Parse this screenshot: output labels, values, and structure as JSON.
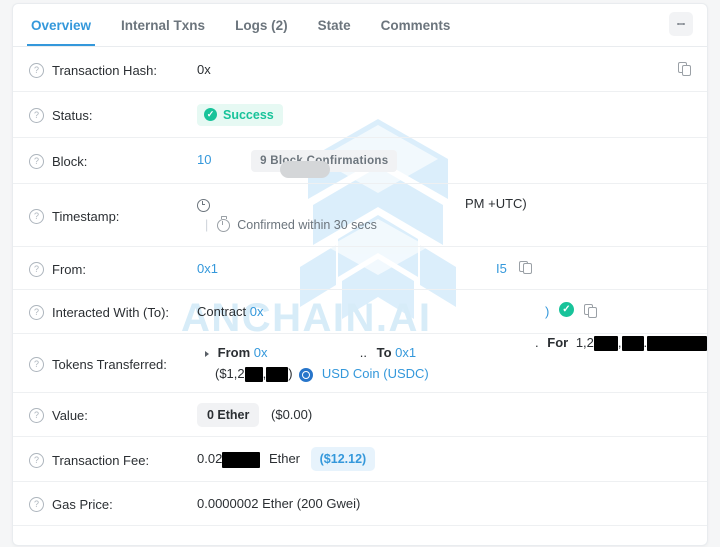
{
  "tabs": {
    "items": [
      {
        "label": "Overview",
        "active": true
      },
      {
        "label": "Internal Txns",
        "active": false
      },
      {
        "label": "Logs (2)",
        "active": false
      },
      {
        "label": "State",
        "active": false
      },
      {
        "label": "Comments",
        "active": false
      }
    ],
    "menu_icon": "kebab-menu-icon"
  },
  "watermark": {
    "text": "ANCHAIN.AI",
    "logo_icon": "hexagon-cube-logo",
    "color": "#d7ecf8"
  },
  "rows": {
    "transaction_hash": {
      "label": "Transaction Hash:",
      "value": "0x",
      "copy_icon": "copy-icon"
    },
    "status": {
      "label": "Status:",
      "value": "Success",
      "icon": "check-circle-icon",
      "badge_bg": "#e6f9f3",
      "badge_fg": "#18c39a"
    },
    "block": {
      "label": "Block:",
      "value": "10",
      "confirmations": "9 Block Confirmations"
    },
    "timestamp": {
      "label": "Timestamp:",
      "clock_icon": "clock-icon",
      "right_text": "PM +UTC)",
      "separator": "|",
      "confirm_icon": "stopwatch-icon",
      "confirm_text": "Confirmed within 30 secs"
    },
    "from": {
      "label": "From:",
      "value": "0x1",
      "tail": "I5",
      "copy_icon": "copy-icon"
    },
    "interacted_with": {
      "label": "Interacted With (To):",
      "prefix": "Contract",
      "value": "0x",
      "tail": ")",
      "verified_icon": "check-circle-icon",
      "copy_icon": "copy-icon"
    },
    "tokens_transferred": {
      "label": "Tokens Transferred:",
      "caret_icon": "caret-right-icon",
      "from_label": "From",
      "from_value": "0x",
      "ellipsis": "..",
      "to_label": "To",
      "to_value": "0x1",
      "period": ".",
      "for_label": "For",
      "for_value": "1,2",
      "usd_value": "($1,2",
      "usd_close": ")",
      "token_icon": "usdc-token-icon",
      "token_name": "USD Coin (USDC)"
    },
    "value": {
      "label": "Value:",
      "amount": "0 Ether",
      "fiat": "($0.00)"
    },
    "transaction_fee": {
      "label": "Transaction Fee:",
      "amount_prefix": "0.02",
      "unit": "Ether",
      "fiat": "($12.12)"
    },
    "gas_price": {
      "label": "Gas Price:",
      "value": "0.0000002 Ether (200 Gwei)"
    }
  },
  "icons": {
    "help": "?"
  }
}
